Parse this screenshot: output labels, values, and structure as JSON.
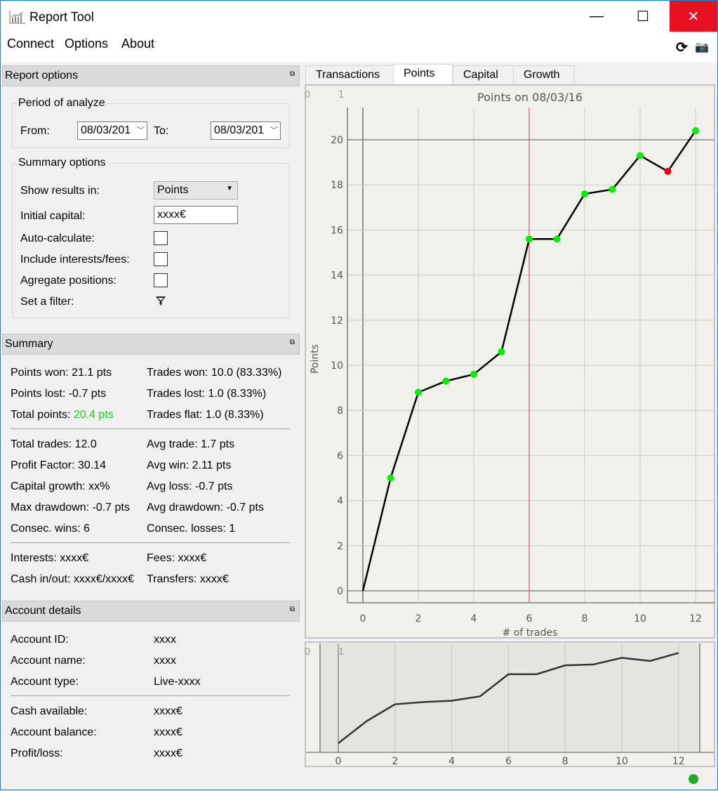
{
  "window": {
    "title": "Report Tool",
    "minimize": "—",
    "maximize": "☐",
    "close": "✕"
  },
  "menu": [
    "Connect",
    "Options",
    "About"
  ],
  "toolbar": {
    "refresh": "⟳",
    "camera": "📷"
  },
  "report_options": {
    "title": "Report options",
    "period_title": "Period of analyze",
    "from_label": "From:",
    "from_value": "08/03/201",
    "to_label": "To:",
    "to_value": "08/03/201",
    "summary_title": "Summary options",
    "show_results_label": "Show results in:",
    "show_results_value": "Points",
    "initial_capital_label": "Initial capital:",
    "initial_capital_value": "xxxx€",
    "auto_calc_label": "Auto-calculate:",
    "include_fees_label": "Include interests/fees:",
    "aggregate_label": "Agregate positions:",
    "filter_label": "Set a filter:"
  },
  "summary": {
    "title": "Summary",
    "left": [
      "Points won: 21.1 pts",
      "Points lost: -0.7 pts",
      "Total points: "
    ],
    "total_points_value": "20.4 pts",
    "right": [
      "Trades won: 10.0 (83.33%)",
      "Trades lost: 1.0 (8.33%)",
      "Trades flat: 1.0 (8.33%)"
    ],
    "left2": [
      "Total trades: 12.0",
      "Profit Factor: 30.14",
      "Capital growth: xx%",
      "Max drawdown: -0.7 pts",
      "Consec. wins: 6"
    ],
    "right2": [
      "Avg trade: 1.7 pts",
      "Avg win: 2.11 pts",
      "Avg loss: -0.7 pts",
      "Avg drawdown: -0.7 pts",
      "Consec. losses: 1"
    ],
    "left3": [
      "Interests: xxxx€",
      "Cash in/out: xxxx€/xxxx€"
    ],
    "right3": [
      "Fees: xxxx€",
      "Transfers: xxxx€"
    ]
  },
  "account": {
    "title": "Account details",
    "rows1": [
      [
        "Account ID:",
        "xxxx"
      ],
      [
        "Account name:",
        "xxxx"
      ],
      [
        "Account type:",
        "Live-xxxx"
      ]
    ],
    "rows2": [
      [
        "Cash available:",
        "xxxx€"
      ],
      [
        "Account balance:",
        "xxxx€"
      ],
      [
        "Profit/loss:",
        "xxxx€"
      ]
    ]
  },
  "tabs": [
    "Transactions",
    "Points",
    "Capital",
    "Growth"
  ],
  "colors": {
    "gain": "#00ee00",
    "loss": "#ee0000",
    "accent_text": "#22cc22",
    "marker": "#ee3344"
  },
  "chart_data": {
    "type": "line",
    "title": "Points on 08/03/16",
    "xlabel": "# of trades",
    "ylabel": "Points",
    "x": [
      0,
      1,
      2,
      3,
      4,
      5,
      6,
      7,
      8,
      9,
      10,
      11,
      12
    ],
    "values": [
      0,
      5.0,
      8.8,
      9.3,
      9.6,
      10.6,
      15.6,
      15.6,
      17.6,
      17.8,
      19.3,
      18.6,
      20.4
    ],
    "xticks": [
      0,
      2,
      4,
      6,
      8,
      10,
      12
    ],
    "yticks": [
      0,
      2,
      4,
      6,
      8,
      10,
      12,
      14,
      16,
      18,
      20
    ],
    "xlim": [
      -0.6,
      12.7
    ],
    "ylim": [
      -0.6,
      21.4
    ],
    "marker_x": 6,
    "corner_labels": [
      "0",
      "1"
    ]
  }
}
